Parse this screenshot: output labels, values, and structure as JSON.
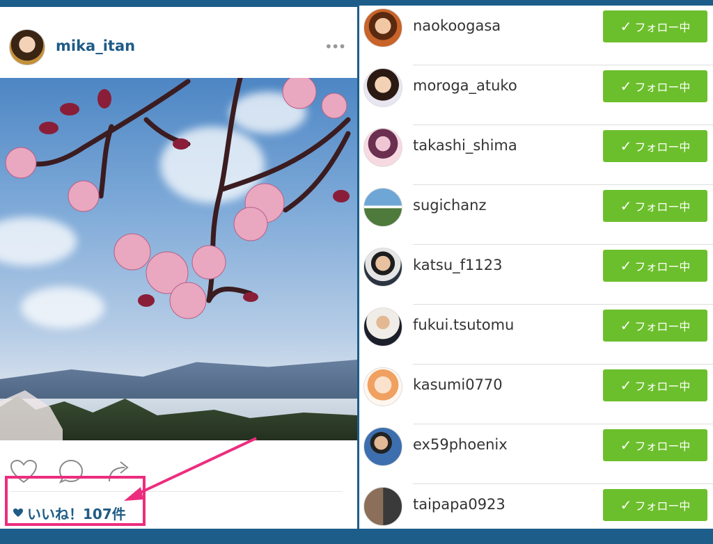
{
  "post": {
    "username": "mika_itan",
    "more_label": "•••",
    "likes_label": "いいね！107件"
  },
  "following": [
    {
      "username": "naokoogasa",
      "button": "フォロー中"
    },
    {
      "username": "moroga_atuko",
      "button": "フォロー中"
    },
    {
      "username": "takashi_shima",
      "button": "フォロー中"
    },
    {
      "username": "sugichanz",
      "button": "フォロー中"
    },
    {
      "username": "katsu_f1123",
      "button": "フォロー中"
    },
    {
      "username": "fukui.tsutomu",
      "button": "フォロー中"
    },
    {
      "username": "kasumi0770",
      "button": "フォロー中"
    },
    {
      "username": "ex59phoenix",
      "button": "フォロー中"
    },
    {
      "username": "taipapa0923",
      "button": "フォロー中"
    }
  ],
  "colors": {
    "username_blue": "#1f5b86",
    "follow_green": "#6cbf2c",
    "highlight_pink": "#ec2d7e"
  },
  "icons": [
    "more-icon",
    "heart-icon",
    "comment-icon",
    "share-icon",
    "check-icon",
    "heart-filled-icon"
  ]
}
